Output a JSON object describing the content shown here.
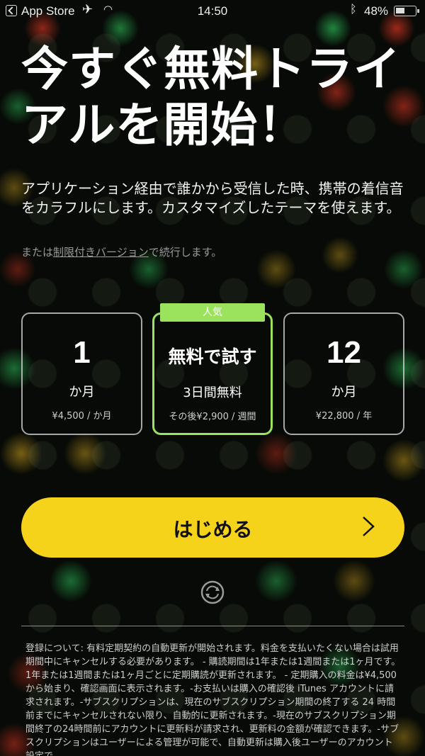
{
  "status_bar": {
    "back_app": "App Store",
    "time": "14:50",
    "battery": "48%"
  },
  "headline": "今すぐ無料トライアルを開始！",
  "description": "アプリケーション経由で誰かから受信した時、携帯の着信音をカラフルにします。カスタマイズしたテーマを使えます。",
  "limited": {
    "prefix": "または",
    "link": "制限付きバージョン",
    "suffix": "で続行します。"
  },
  "plans": [
    {
      "big": "1",
      "mid": "か月",
      "small": "¥4,500 / か月"
    },
    {
      "badge": "人気",
      "big": "無料で試す",
      "mid": "3日間無料",
      "small": "その後¥2,900 / 週間"
    },
    {
      "big": "12",
      "mid": "か月",
      "small": "¥22,800 / 年"
    }
  ],
  "start_button": {
    "label": "はじめる"
  },
  "legal_text": "登録について: 有料定期契約の自動更新が開始されます。料金を支払いたくない場合は試用期間中にキャンセルする必要があります。 - 購読期間は1年または1週間または1ヶ月です。 1年または1週間または1ヶ月ごとに定期購読が更新されます。 - 定期購入の料金は¥4,500から始まり、確認画面に表示されます。-お支払いは購入の確認後 iTunes アカウントに請求されます。-サブスクリプションは、現在のサブスクリプション期間の終了する 24 時間前までにキャンセルされない限り、自動的に更新されます。-現在のサブスクリプション期間終了の24時間前にアカウントに更新料が請求され、更新料の金額が確認できます。-サブスクリプションはユーザーによる管理が可能で、自動更新は購入後ユーザーのアカウント設定で",
  "colors": {
    "accent_yellow": "#f5d31a",
    "popular_green": "#9be35c"
  }
}
